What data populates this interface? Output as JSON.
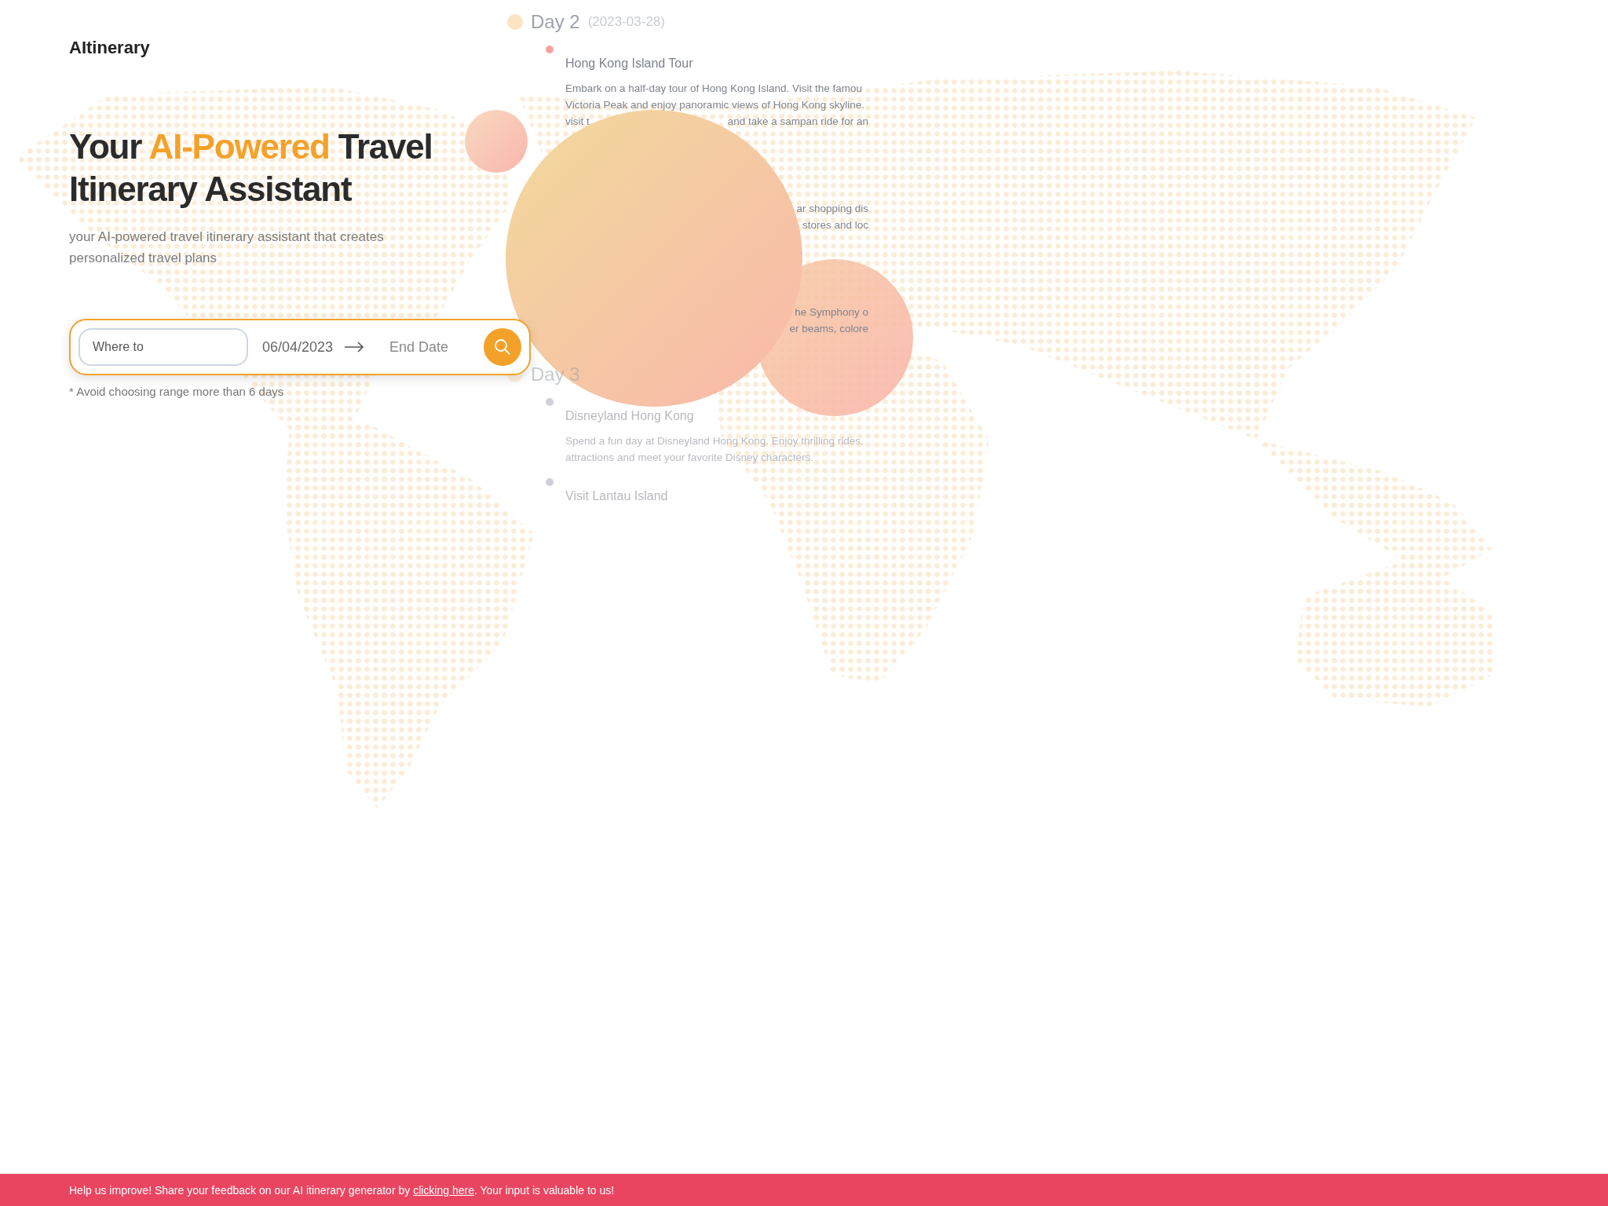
{
  "brand": {
    "logo": "AItinerary"
  },
  "hero": {
    "headline": [
      {
        "text": "Your ",
        "highlight": false
      },
      {
        "text": "AI-Powered",
        "highlight": true
      },
      {
        "text": " Travel Itinerary Assistant",
        "highlight": false
      }
    ],
    "subtitle": "your AI-powered travel itinerary assistant that creates personalized travel plans"
  },
  "search": {
    "destination": {
      "placeholder": "Where to"
    },
    "start_date": {
      "value": "06/04/2023"
    },
    "end_date": {
      "placeholder": "End Date"
    },
    "hint": "* Avoid choosing range more than 6 days"
  },
  "itinerary_preview": {
    "days": [
      {
        "label": "Day 2",
        "date": "(2023-03-28)",
        "faded": false,
        "activities": [
          {
            "title": "Hong Kong Island Tour",
            "lines": [
              {
                "left": "Embark on a half-day tour of Hong Kong Island. Visit the famou"
              },
              {
                "left": "Victoria Peak and enjoy panoramic views of Hong Kong skyline."
              },
              {
                "left": "visit t",
                "right": "and take a sampan ride for an"
              }
            ]
          },
          {
            "lines": [
              {
                "right": "ar shopping dis"
              },
              {
                "right": "stores and loc"
              }
            ]
          },
          {
            "lines": [
              {
                "right": "he Symphony o"
              },
              {
                "right": "er beams, colore"
              }
            ]
          }
        ]
      },
      {
        "label": "Day 3",
        "faded": true,
        "activities": [
          {
            "title": "Disneyland Hong Kong",
            "lines": [
              {
                "left": "Spend a fun day at Disneyland Hong Kong. Enjoy thrilling rides,"
              },
              {
                "left": "attractions and meet your favorite Disney characters."
              }
            ]
          },
          {
            "title": "Visit Lantau Island"
          }
        ]
      }
    ]
  },
  "feedback_banner": {
    "before": "Help us improve! Share your feedback on our AI itinerary generator by ",
    "link": "clicking here",
    "after": ". Your input is valuable to us!"
  }
}
